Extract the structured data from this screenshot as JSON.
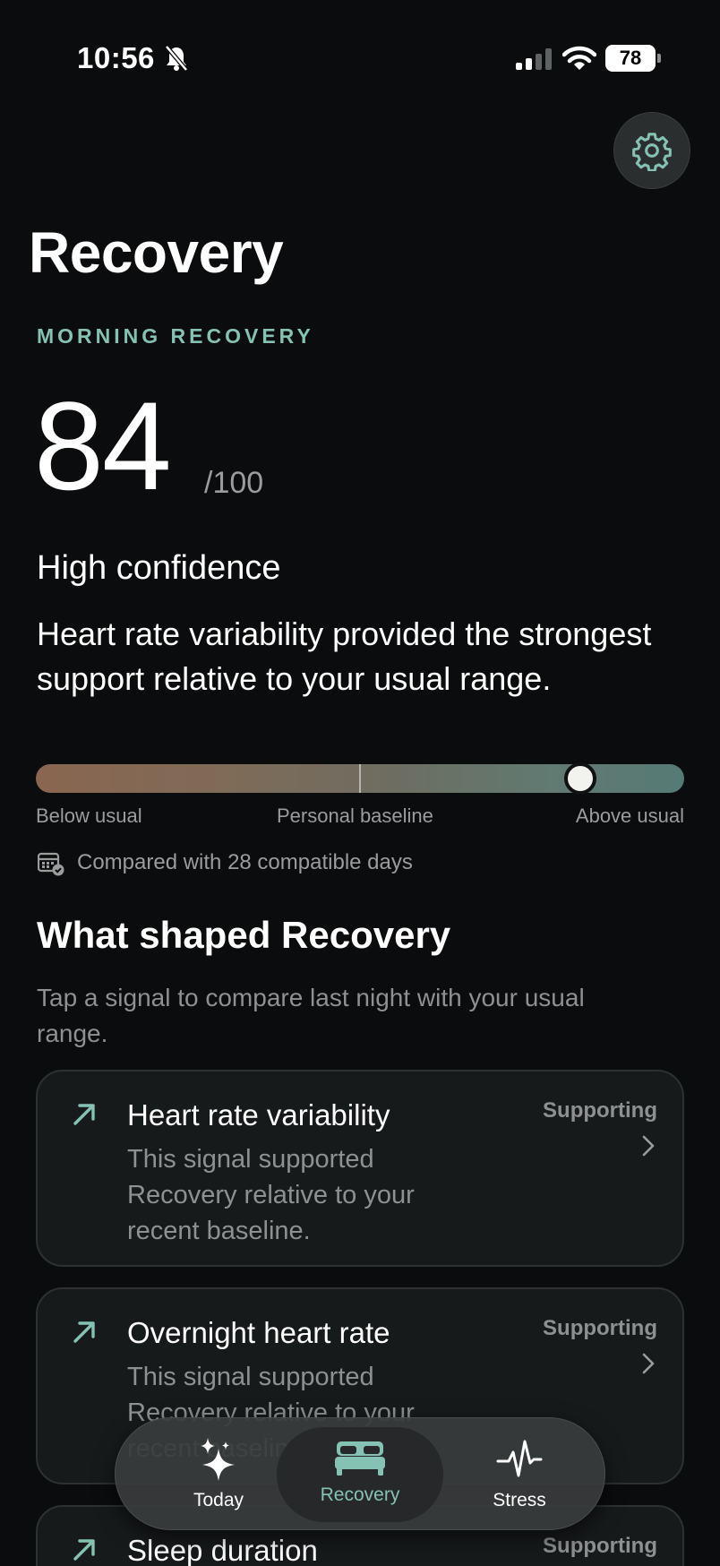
{
  "status_bar": {
    "time": "10:56",
    "battery": "78"
  },
  "header": {
    "title": "Recovery"
  },
  "recovery": {
    "eyebrow": "MORNING RECOVERY",
    "score": "84",
    "score_suffix": "/100",
    "score_value": 84,
    "confidence": "High confidence",
    "summary": "Heart rate variability provided the strongest support relative to your usual range."
  },
  "range": {
    "below_label": "Below usual",
    "baseline_label": "Personal baseline",
    "above_label": "Above usual",
    "position_fraction": 0.84
  },
  "comparison": {
    "text": "Compared with 28 compatible days"
  },
  "section": {
    "title": "What shaped Recovery",
    "subtitle": "Tap a signal to compare last night with your usual range."
  },
  "signals": [
    {
      "title": "Heart rate variability",
      "description": "This signal supported Recovery relative to your recent baseline.",
      "status": "Supporting"
    },
    {
      "title": "Overnight heart rate",
      "description": "This signal supported Recovery relative to your recent baseline.",
      "status": "Supporting"
    },
    {
      "title": "Sleep duration",
      "description": "",
      "status": "Supporting"
    }
  ],
  "tabs": [
    {
      "label": "Today",
      "icon": "sparkles-icon"
    },
    {
      "label": "Recovery",
      "icon": "bed-icon",
      "active": true
    },
    {
      "label": "Stress",
      "icon": "heartbeat-icon"
    }
  ],
  "colors": {
    "accent": "#86c2b3",
    "background": "#0b0c0d",
    "card": "#171a1b"
  }
}
